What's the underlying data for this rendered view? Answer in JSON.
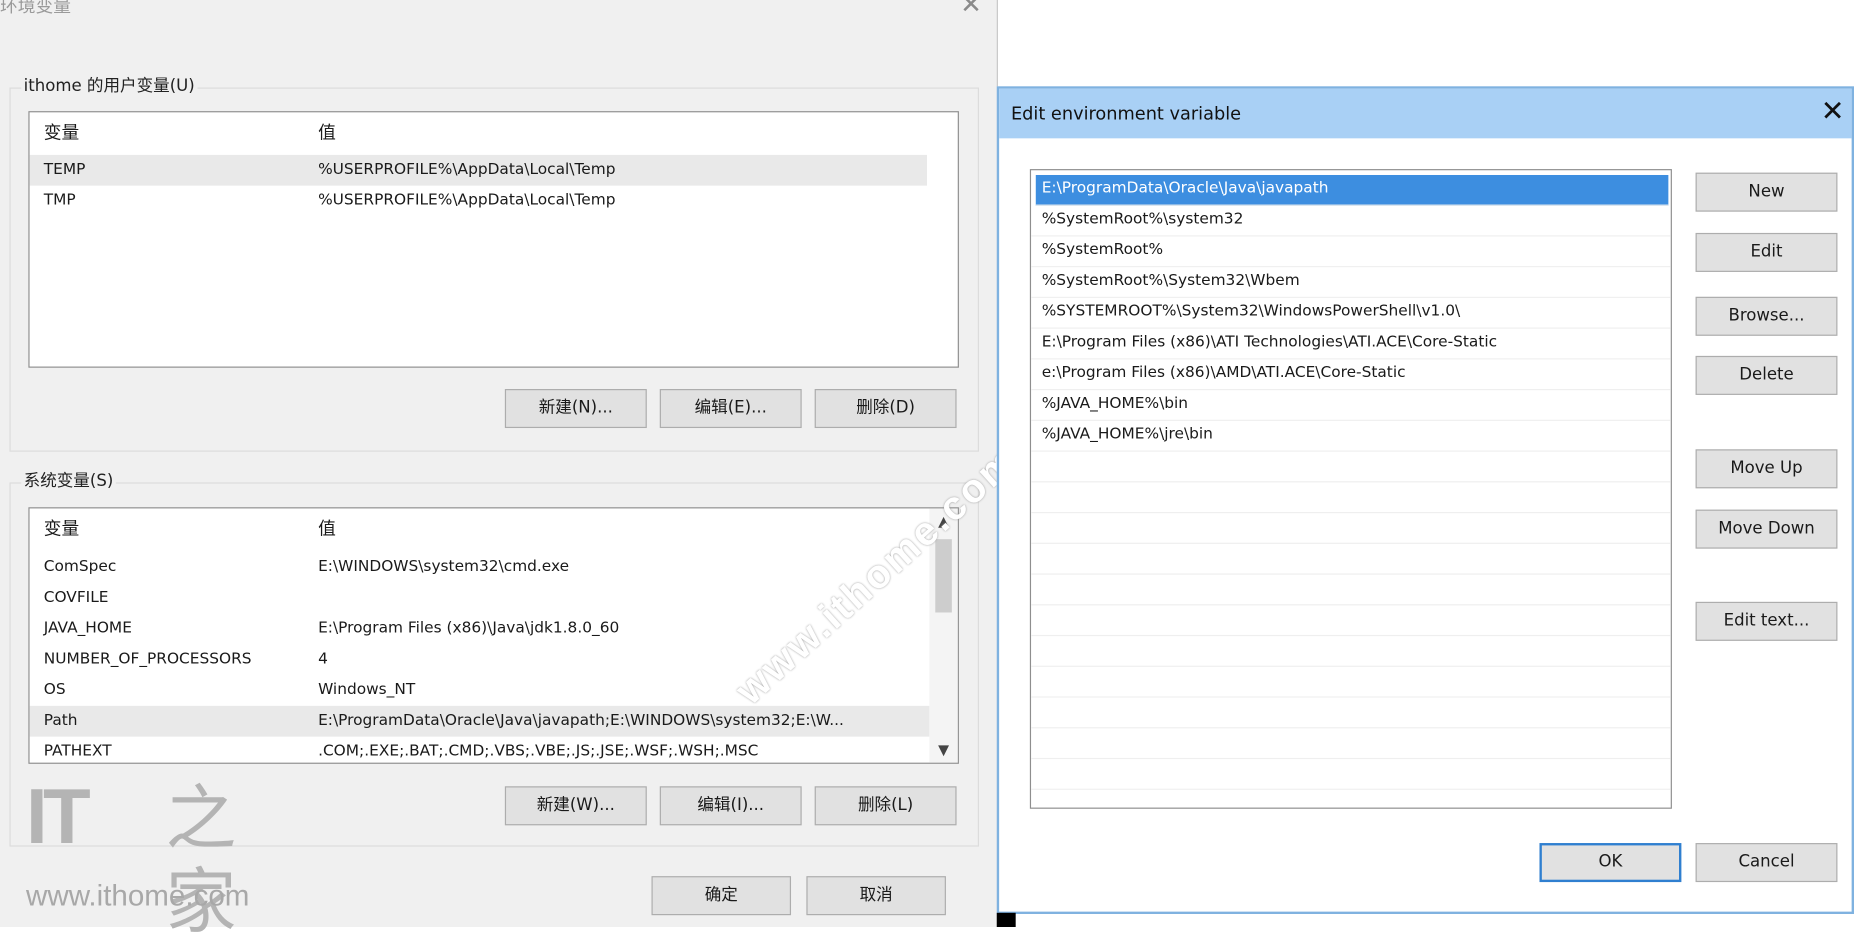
{
  "env_dialog": {
    "title": "环境变量",
    "close_glyph": "✕",
    "user_vars": {
      "label": "ithome 的用户变量(U)",
      "col_name": "变量",
      "col_value": "值",
      "rows": [
        {
          "name": "TEMP",
          "value": "%USERPROFILE%\\AppData\\Local\\Temp"
        },
        {
          "name": "TMP",
          "value": "%USERPROFILE%\\AppData\\Local\\Temp"
        }
      ],
      "new_label": "新建(N)...",
      "edit_label": "编辑(E)...",
      "delete_label": "删除(D)"
    },
    "system_vars": {
      "label": "系统变量(S)",
      "col_name": "变量",
      "col_value": "值",
      "rows": [
        {
          "name": "ComSpec",
          "value": "E:\\WINDOWS\\system32\\cmd.exe"
        },
        {
          "name": "COVFILE",
          "value": ""
        },
        {
          "name": "JAVA_HOME",
          "value": "E:\\Program Files (x86)\\Java\\jdk1.8.0_60"
        },
        {
          "name": "NUMBER_OF_PROCESSORS",
          "value": "4"
        },
        {
          "name": "OS",
          "value": "Windows_NT"
        },
        {
          "name": "Path",
          "value": "E:\\ProgramData\\Oracle\\Java\\javapath;E:\\WINDOWS\\system32;E:\\W..."
        },
        {
          "name": "PATHEXT",
          "value": ".COM;.EXE;.BAT;.CMD;.VBS;.VBE;.JS;.JSE;.WSF;.WSH;.MSC"
        }
      ],
      "new_label": "新建(W)...",
      "edit_label": "编辑(I)...",
      "delete_label": "删除(L)"
    },
    "ok_label": "确定",
    "cancel_label": "取消"
  },
  "edit_dialog": {
    "title": "Edit environment variable",
    "close_glyph": "✕",
    "paths": [
      "E:\\ProgramData\\Oracle\\Java\\javapath",
      "%SystemRoot%\\system32",
      "%SystemRoot%",
      "%SystemRoot%\\System32\\Wbem",
      "%SYSTEMROOT%\\System32\\WindowsPowerShell\\v1.0\\",
      "E:\\Program Files (x86)\\ATI Technologies\\ATI.ACE\\Core-Static",
      "e:\\Program Files (x86)\\AMD\\ATI.ACE\\Core-Static",
      "%JAVA_HOME%\\bin",
      "%JAVA_HOME%\\jre\\bin"
    ],
    "buttons": {
      "new": "New",
      "edit": "Edit",
      "browse": "Browse...",
      "delete": "Delete",
      "move_up": "Move Up",
      "move_down": "Move Down",
      "edit_text": "Edit text...",
      "ok": "OK",
      "cancel": "Cancel"
    }
  },
  "watermark": {
    "logo_it": "IT",
    "logo_cn": "之家",
    "url": "www.ithome.com",
    "diagonal": "www.ithome.com"
  },
  "colors": {
    "title_bar": "#a9d0f5",
    "selection": "#3d8ee0",
    "dialog_bg": "#f0f0f0",
    "button_bg": "#e1e1e1"
  }
}
